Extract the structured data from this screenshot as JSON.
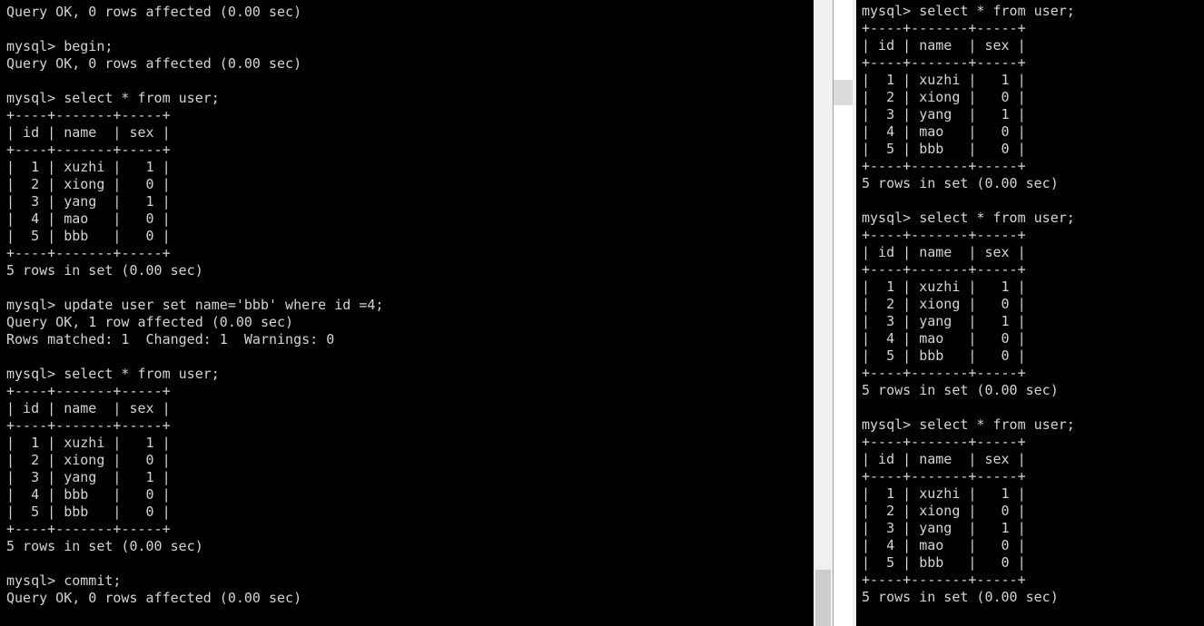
{
  "left_terminal": {
    "lines": [
      "Query OK, 0 rows affected (0.00 sec)",
      "",
      "mysql> begin;",
      "Query OK, 0 rows affected (0.00 sec)",
      "",
      "mysql> select * from user;",
      "+----+-------+-----+",
      "| id | name  | sex |",
      "+----+-------+-----+",
      "|  1 | xuzhi |   1 |",
      "|  2 | xiong |   0 |",
      "|  3 | yang  |   1 |",
      "|  4 | mao   |   0 |",
      "|  5 | bbb   |   0 |",
      "+----+-------+-----+",
      "5 rows in set (0.00 sec)",
      "",
      "mysql> update user set name='bbb' where id =4;",
      "Query OK, 1 row affected (0.00 sec)",
      "Rows matched: 1  Changed: 1  Warnings: 0",
      "",
      "mysql> select * from user;",
      "+----+-------+-----+",
      "| id | name  | sex |",
      "+----+-------+-----+",
      "|  1 | xuzhi |   1 |",
      "|  2 | xiong |   0 |",
      "|  3 | yang  |   1 |",
      "|  4 | bbb   |   0 |",
      "|  5 | bbb   |   0 |",
      "+----+-------+-----+",
      "5 rows in set (0.00 sec)",
      "",
      "mysql> commit;",
      "Query OK, 0 rows affected (0.00 sec)"
    ]
  },
  "right_terminal": {
    "lines": [
      "mysql> select * from user;",
      "+----+-------+-----+",
      "| id | name  | sex |",
      "+----+-------+-----+",
      "|  1 | xuzhi |   1 |",
      "|  2 | xiong |   0 |",
      "|  3 | yang  |   1 |",
      "|  4 | mao   |   0 |",
      "|  5 | bbb   |   0 |",
      "+----+-------+-----+",
      "5 rows in set (0.00 sec)",
      "",
      "mysql> select * from user;",
      "+----+-------+-----+",
      "| id | name  | sex |",
      "+----+-------+-----+",
      "|  1 | xuzhi |   1 |",
      "|  2 | xiong |   0 |",
      "|  3 | yang  |   1 |",
      "|  4 | mao   |   0 |",
      "|  5 | bbb   |   0 |",
      "+----+-------+-----+",
      "5 rows in set (0.00 sec)",
      "",
      "mysql> select * from user;",
      "+----+-------+-----+",
      "| id | name  | sex |",
      "+----+-------+-----+",
      "|  1 | xuzhi |   1 |",
      "|  2 | xiong |   0 |",
      "|  3 | yang  |   1 |",
      "|  4 | mao   |   0 |",
      "|  5 | bbb   |   0 |",
      "+----+-------+-----+",
      "5 rows in set (0.00 sec)",
      ""
    ],
    "cursor_color": "#00ff00"
  },
  "colors": {
    "background": "#000000",
    "text": "#d4d4d4"
  }
}
